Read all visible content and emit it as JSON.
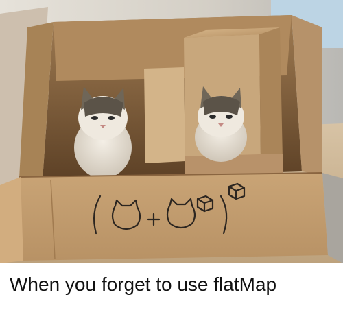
{
  "caption": {
    "text": "When you forget to use flatMap"
  },
  "photo": {
    "box_markings": {
      "left_paren": "(",
      "plus": "+",
      "right_paren": ")"
    },
    "icons": [
      "cat-face-icon",
      "cat-face-icon",
      "box-icon",
      "box-icon"
    ]
  },
  "colors": {
    "cardboard": "#c49a6c",
    "cardboard_dark": "#8a6540",
    "background_wall": "#d8d2c6",
    "caption_text": "#111111"
  }
}
